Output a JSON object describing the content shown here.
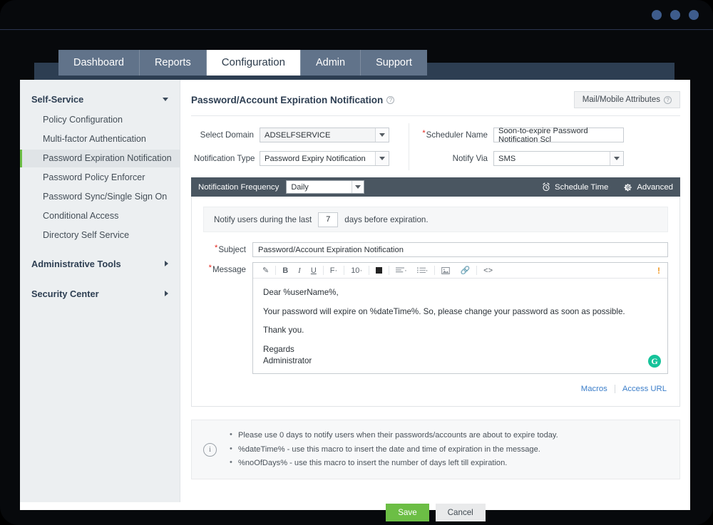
{
  "window": {
    "dots_count": 3,
    "dot_color": "#3e5c8c"
  },
  "tabs": [
    {
      "label": "Dashboard",
      "active": false
    },
    {
      "label": "Reports",
      "active": false
    },
    {
      "label": "Configuration",
      "active": true
    },
    {
      "label": "Admin",
      "active": false
    },
    {
      "label": "Support",
      "active": false
    }
  ],
  "sidebar": {
    "groups": [
      {
        "label": "Self-Service",
        "expanded": true,
        "caret": "caret-down-icon"
      },
      {
        "label": "Administrative Tools",
        "expanded": false,
        "caret": "caret-right-icon"
      },
      {
        "label": "Security Center",
        "expanded": false,
        "caret": "caret-right-icon"
      }
    ],
    "items": [
      {
        "label": "Policy Configuration",
        "selected": false
      },
      {
        "label": "Multi-factor Authentication",
        "selected": false
      },
      {
        "label": "Password Expiration Notification",
        "selected": true
      },
      {
        "label": "Password Policy Enforcer",
        "selected": false
      },
      {
        "label": "Password Sync/Single Sign On",
        "selected": false
      },
      {
        "label": "Conditional Access",
        "selected": false
      },
      {
        "label": "Directory Self Service",
        "selected": false
      }
    ],
    "selected_accent": "#6cbe45"
  },
  "header": {
    "title": "Password/Account Expiration Notification",
    "help_icon": "question-circle-icon",
    "attributes_button": "Mail/Mobile Attributes"
  },
  "form": {
    "select_domain": {
      "label": "Select Domain",
      "value": "ADSELFSERVICE"
    },
    "notification_type": {
      "label": "Notification Type",
      "value": "Password Expiry Notification"
    },
    "scheduler_name": {
      "label": "Scheduler Name",
      "value": "Soon-to-expire Password Notification Scl",
      "required": true
    },
    "notify_via": {
      "label": "Notify Via",
      "value": "SMS"
    }
  },
  "frequency_bar": {
    "label": "Notification Frequency",
    "value": "Daily",
    "schedule_time": "Schedule Time",
    "schedule_time_icon": "alarm-clock-icon",
    "advanced": "Advanced",
    "advanced_icon": "gear-icon",
    "background": "#4a5661"
  },
  "notify_strip": {
    "prefix": "Notify users during the last",
    "days": "7",
    "suffix": "days before expiration."
  },
  "editor": {
    "subject_label": "Subject",
    "subject_value": "Password/Account Expiration Notification",
    "message_label": "Message",
    "toolbar": [
      {
        "name": "pencil-icon",
        "glyph": "✎"
      },
      {
        "name": "bold-icon",
        "glyph": "B"
      },
      {
        "name": "italic-icon",
        "glyph": "I"
      },
      {
        "name": "underline-icon",
        "glyph": "U"
      },
      {
        "name": "font-family-icon",
        "glyph": "F"
      },
      {
        "name": "font-size-selector",
        "glyph": "10"
      },
      {
        "name": "text-color-swatch",
        "glyph": ""
      },
      {
        "name": "align-icon",
        "glyph": ""
      },
      {
        "name": "list-icon",
        "glyph": ""
      },
      {
        "name": "image-icon",
        "glyph": ""
      },
      {
        "name": "link-icon",
        "glyph": ""
      },
      {
        "name": "source-code-icon",
        "glyph": "<>"
      }
    ],
    "warning_glyph": "!",
    "body": [
      "Dear %userName%,",
      "Your password will expire on %dateTime%. So, please change your password as soon as possible.",
      "Thank you.",
      "Regards",
      "Administrator"
    ],
    "grammarly_icon": "G",
    "links": [
      {
        "label": "Macros"
      },
      {
        "label": "Access URL"
      }
    ]
  },
  "note": {
    "icon": "info-circle-icon",
    "bullets": [
      "Please use 0 days to notify users when their passwords/accounts are about to expire today.",
      "%dateTime% - use this macro to insert the date and time of expiration in the message.",
      "%noOfDays% - use this macro to insert the number of days left till expiration."
    ]
  },
  "actions": {
    "save": "Save",
    "cancel": "Cancel",
    "save_color": "#6cbe45"
  }
}
